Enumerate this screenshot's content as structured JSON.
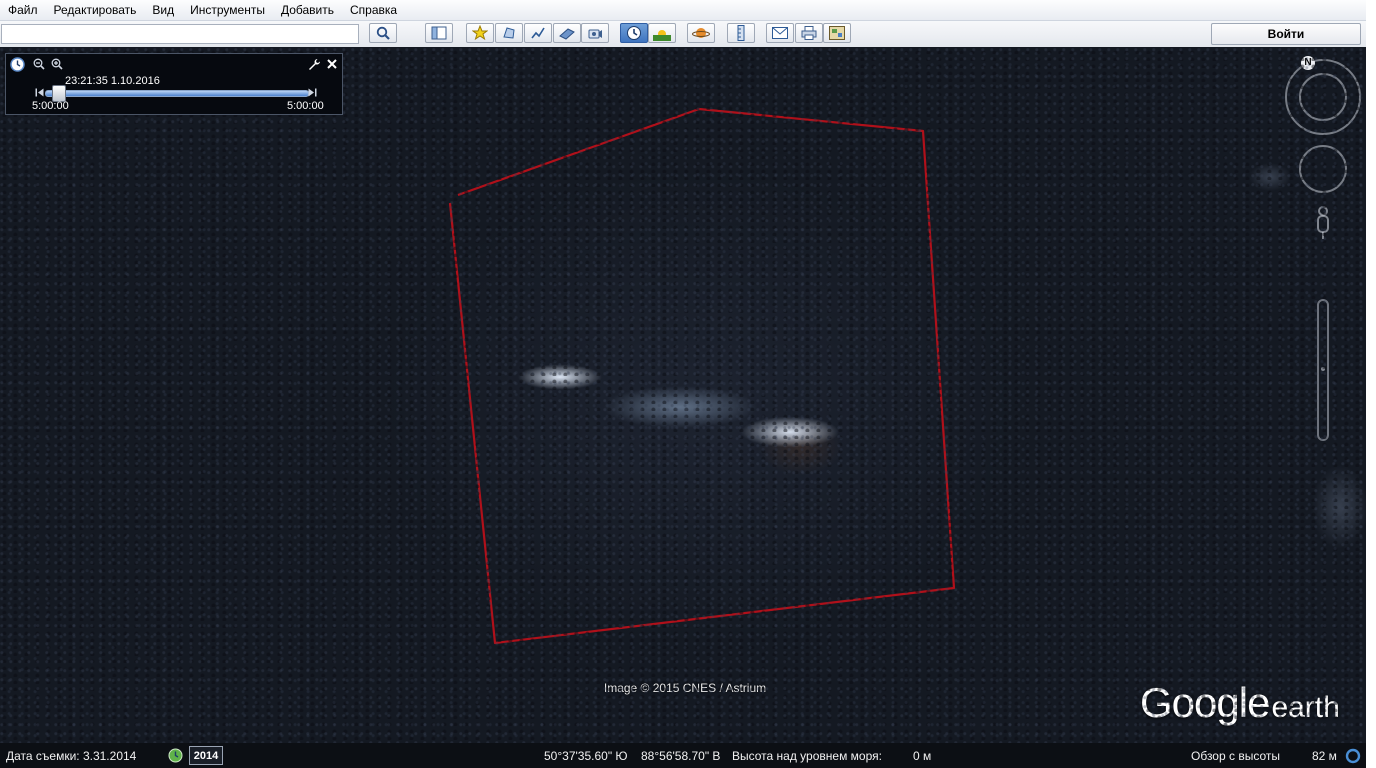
{
  "menu": [
    "Файл",
    "Редактировать",
    "Вид",
    "Инструменты",
    "Добавить",
    "Справка"
  ],
  "search": {
    "value": "",
    "placeholder": ""
  },
  "toolbar": {
    "buttons": [
      "search-icon",
      "sidebar-icon",
      "placemark-icon",
      "polygon-icon",
      "path-icon",
      "image-overlay-icon",
      "tour-icon",
      "historical-imagery-icon",
      "sunlight-icon",
      "planets-icon",
      "ruler-icon",
      "email-icon",
      "print-icon",
      "view-in-maps-icon"
    ],
    "signin_label": "Войти"
  },
  "time_slider": {
    "current": "23:21:35 1.10.2016",
    "start": "5:00:00",
    "end": "5:00:00",
    "position": 0.05
  },
  "map": {
    "imagery_credit": "Image © 2015 CNES / Astrium",
    "logo_main": "Google",
    "logo_sub": "earth",
    "outline_color": "#b0101a"
  },
  "navigation": {
    "north_label": "N"
  },
  "status": {
    "capture_date": "Дата съемки: 3.31.2014",
    "year_badge": "2014",
    "latitude": "50°37'35.60\" Ю",
    "longitude": "88°56'58.70\" В",
    "elevation_label": "Высота над уровнем моря:",
    "elevation_value": "0 м",
    "eye_alt_label": "Обзор с высоты",
    "eye_alt_value": "82 м"
  }
}
